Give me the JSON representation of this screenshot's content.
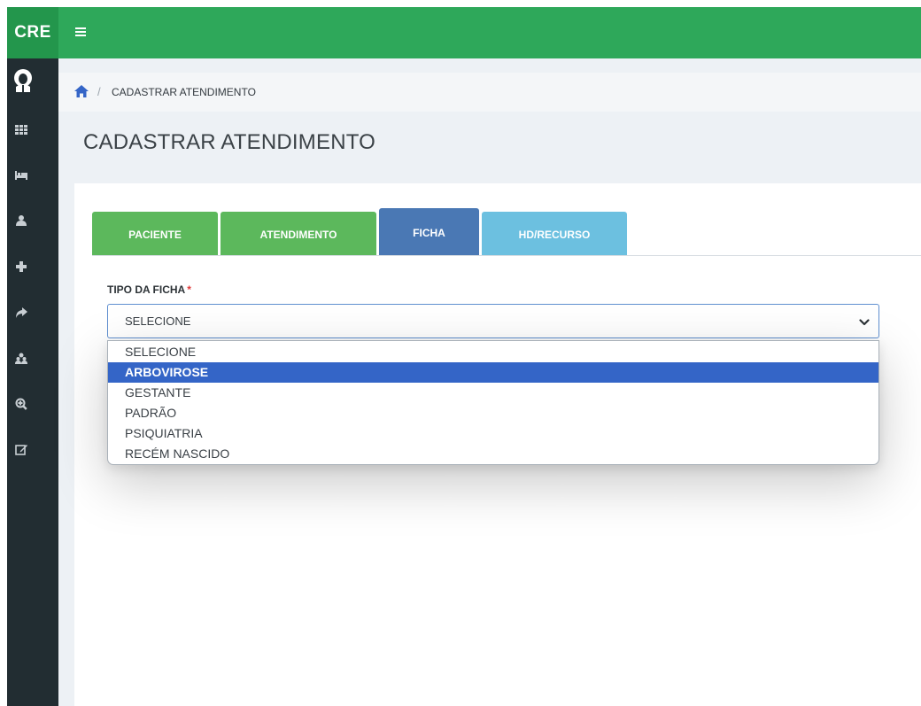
{
  "brand": "CRE",
  "breadcrumb": {
    "separator": "/",
    "current": "CADASTRAR ATENDIMENTO"
  },
  "page_title": "CADASTRAR ATENDIMENTO",
  "tabs": [
    {
      "label": "PACIENTE",
      "color": "#5cb85c"
    },
    {
      "label": "ATENDIMENTO",
      "color": "#5cb85c"
    },
    {
      "label": "FICHA",
      "color": "#4a78b4",
      "active": true
    },
    {
      "label": "HD/RECURSO",
      "color": "#6cc0e0"
    }
  ],
  "form": {
    "tipo_label": "TIPO DA FICHA",
    "required_mark": "*",
    "selected_value": "SELECIONE",
    "options": [
      "SELECIONE",
      "ARBOVIROSE",
      "GESTANTE",
      "PADRÃO",
      "PSIQUIATRIA",
      "RECÉM NASCIDO"
    ],
    "highlighted_option": "ARBOVIROSE"
  },
  "sidebar_icons": [
    "avatar",
    "grid-icon",
    "bed-icon",
    "user-icon",
    "plus-icon",
    "share-icon",
    "users-icon",
    "zoom-in-icon",
    "edit-icon"
  ],
  "colors": {
    "topbar": "#2ea85a",
    "sidebar": "#222d32",
    "accent": "#3465c7"
  }
}
